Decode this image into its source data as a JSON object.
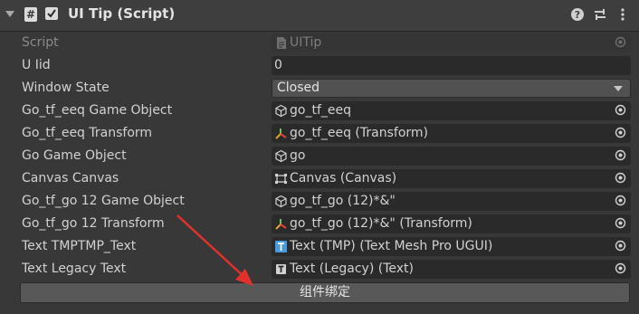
{
  "component": {
    "title": "UI Tip (Script)"
  },
  "fields": {
    "script": {
      "label": "Script",
      "value": "UITip"
    },
    "ui_id": {
      "label": "U Iid",
      "value": "0"
    },
    "window_state": {
      "label": "Window State",
      "value": "Closed"
    },
    "go_tf_eeq_go": {
      "label": "Go_tf_eeq Game Object",
      "value": "go_tf_eeq"
    },
    "go_tf_eeq_tf": {
      "label": "Go_tf_eeq Transform",
      "value": "go_tf_eeq (Transform)"
    },
    "go_go": {
      "label": "Go Game Object",
      "value": "go"
    },
    "canvas": {
      "label": "Canvas Canvas",
      "value": "Canvas (Canvas)"
    },
    "go_tf_go12_go": {
      "label": "Go_tf_go 12 Game Object",
      "value": "go_tf_go (12)*&\""
    },
    "go_tf_go12_tf": {
      "label": "Go_tf_go 12 Transform",
      "value": "go_tf_go (12)*&\" (Transform)"
    },
    "text_tmp": {
      "label": "Text TMPTMP_Text",
      "value": "Text (TMP) (Text Mesh Pro UGUI)"
    },
    "text_legacy": {
      "label": "Text Legacy Text",
      "value": "Text (Legacy) (Text)"
    }
  },
  "bind_button": {
    "label": "组件绑定"
  },
  "icons": {
    "script_asset": "script-file-icon",
    "game_object": "cube-icon",
    "transform": "transform-axes-icon",
    "canvas": "canvas-icon",
    "tmp": "tmp-text-icon",
    "legacy_text": "text-icon"
  },
  "colors": {
    "arrow": "#e0322a",
    "background": "#383838",
    "field": "#2a2a2a"
  }
}
